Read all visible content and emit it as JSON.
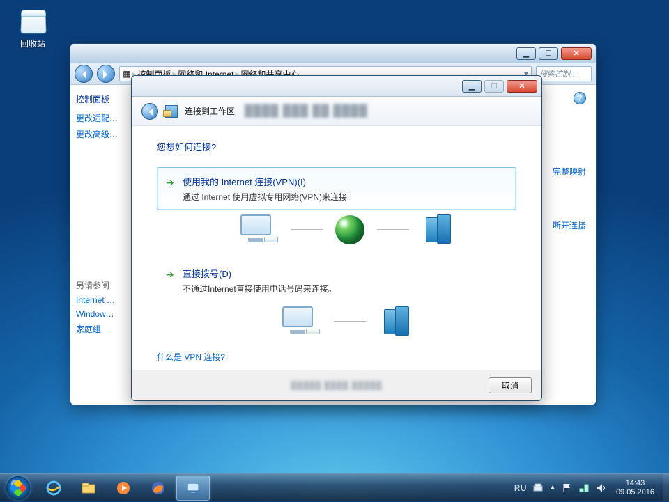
{
  "desktop": {
    "recycle_bin": "回收站"
  },
  "control_panel": {
    "breadcrumb": {
      "l1": "控制面板",
      "l2": "网络和 Internet",
      "l3": "网络和共享中心"
    },
    "search_placeholder": "搜索控制…",
    "side": {
      "header": "控制面板",
      "link1": "更改适配…",
      "link2": "更改高级…",
      "see_also": "另请参阅",
      "sa1": "Internet …",
      "sa2": "Window…",
      "sa3": "家庭组"
    },
    "peek": {
      "p1": "完整映射",
      "p2": "断开连接"
    }
  },
  "wizard": {
    "title": "连接到工作区",
    "question": "您想如何连接?",
    "opt1": {
      "title": "使用我的 Internet 连接(VPN)(I)",
      "desc": "通过 Internet 使用虚拟专用网络(VPN)来连接"
    },
    "opt2": {
      "title": "直接拨号(D)",
      "desc": "不通过Internet直接使用电话号码来连接。"
    },
    "link_whatisvpn": "什么是 VPN 连接?",
    "cancel": "取消"
  },
  "taskbar": {
    "lang": "RU",
    "time": "14:43",
    "date": "09.05.2016"
  }
}
